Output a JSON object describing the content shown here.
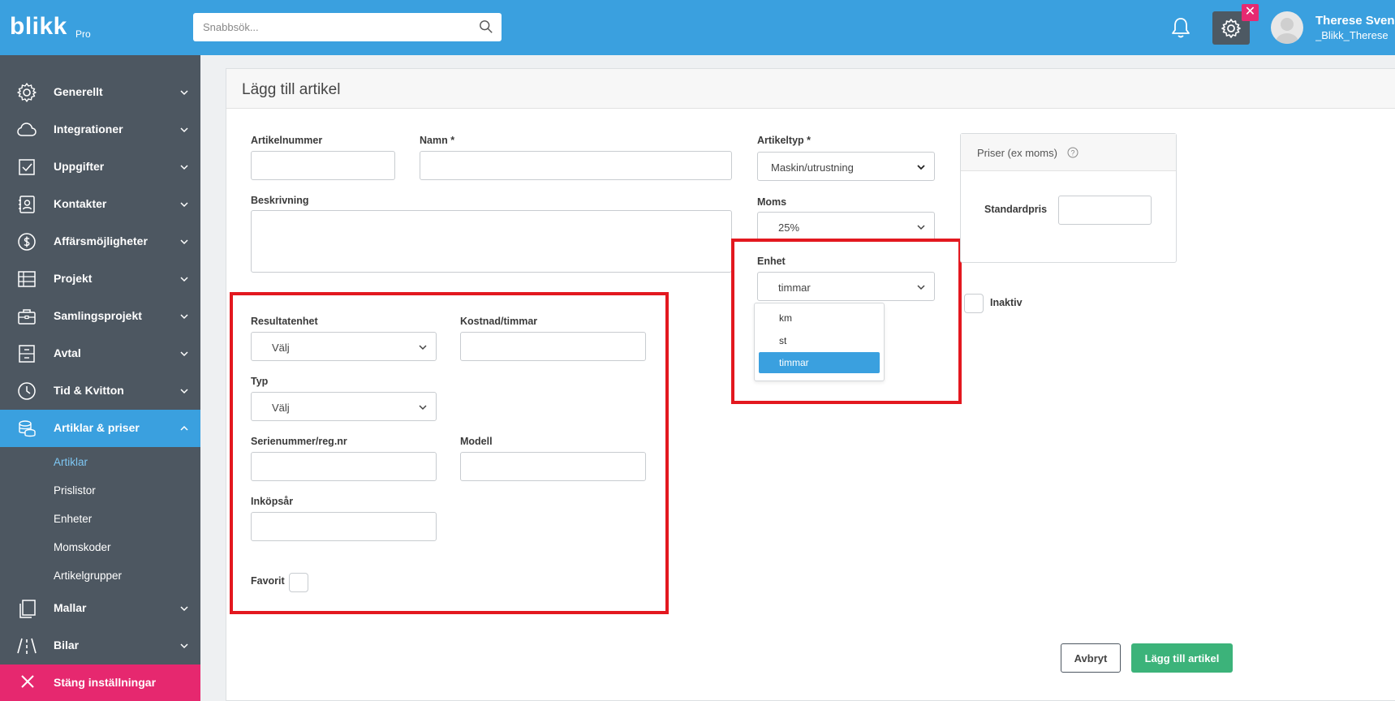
{
  "topbar": {
    "logo": "blikk",
    "logo_sub": "Pro",
    "search_placeholder": "Snabbsök...",
    "user_name": "Therese Svensson",
    "user_handle": "_Blikk_Therese"
  },
  "sidebar": {
    "items": [
      {
        "label": "Generellt",
        "icon": "gear-icon"
      },
      {
        "label": "Integrationer",
        "icon": "cloud-icon"
      },
      {
        "label": "Uppgifter",
        "icon": "checkbox-icon"
      },
      {
        "label": "Kontakter",
        "icon": "contact-book-icon"
      },
      {
        "label": "Affärsmöjligheter",
        "icon": "dollar-icon"
      },
      {
        "label": "Projekt",
        "icon": "table-icon"
      },
      {
        "label": "Samlingsprojekt",
        "icon": "briefcase-icon"
      },
      {
        "label": "Avtal",
        "icon": "cabinet-icon"
      },
      {
        "label": "Tid & Kvitton",
        "icon": "clock-icon"
      },
      {
        "label": "Artiklar & priser",
        "icon": "coins-icon"
      },
      {
        "label": "Mallar",
        "icon": "copy-icon"
      },
      {
        "label": "Bilar",
        "icon": "road-icon"
      }
    ],
    "sub_items": [
      "Artiklar",
      "Prislistor",
      "Enheter",
      "Momskoder",
      "Artikelgrupper"
    ],
    "close_label": "Stäng inställningar"
  },
  "form": {
    "title": "Lägg till artikel",
    "artikelnummer_label": "Artikelnummer",
    "namn_label": "Namn *",
    "artikeltyp_label": "Artikeltyp *",
    "artikeltyp_value": "Maskin/utrustning",
    "beskrivning_label": "Beskrivning",
    "moms_label": "Moms",
    "moms_value": "25%",
    "enhet_label": "Enhet",
    "enhet_value": "timmar",
    "enhet_options": [
      "km",
      "st",
      "timmar"
    ],
    "inaktiv_label": "Inaktiv",
    "resultatenhet_label": "Resultatenhet",
    "resultatenhet_value": "Välj",
    "kostnad_label": "Kostnad/timmar",
    "typ_label": "Typ",
    "typ_value": "Välj",
    "serienummer_label": "Serienummer/reg.nr",
    "modell_label": "Modell",
    "inkopsar_label": "Inköpsår",
    "favorit_label": "Favorit"
  },
  "prices": {
    "title": "Priser (ex moms)",
    "standardpris_label": "Standardpris"
  },
  "buttons": {
    "cancel": "Avbryt",
    "add": "Lägg till artikel"
  },
  "colors": {
    "brand": "#3aa0df",
    "sidebar": "#4d5761",
    "close": "#e6286f",
    "primary_button": "#3cb37a",
    "highlight": "#e3181f"
  }
}
